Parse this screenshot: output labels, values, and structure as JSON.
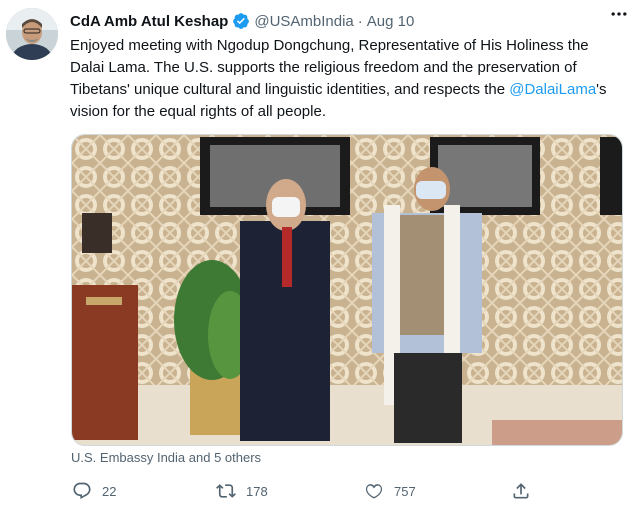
{
  "tweet": {
    "author_name": "CdA Amb Atul Keshap",
    "handle": "@USAmbIndia",
    "separator": "·",
    "date": "Aug 10",
    "text_before_mention": "Enjoyed meeting with Ngodup Dongchung, Representative of His Holiness the Dalai Lama. The U.S. supports the religious freedom and the preservation of Tibetans' unique cultural and linguistic identities, and respects the ",
    "mention": "@DalaiLama",
    "text_after_mention": "'s vision for the equal rights of all people.",
    "media_caption": "U.S. Embassy India and 5 others"
  },
  "actions": {
    "reply_count": "22",
    "retweet_count": "178",
    "like_count": "757"
  },
  "icons": {
    "verified": "verified-badge-icon",
    "more": "more-horizontal-icon",
    "reply": "reply-icon",
    "retweet": "retweet-icon",
    "like": "heart-icon",
    "share": "share-icon"
  },
  "colors": {
    "link": "#1d9bf0",
    "verified": "#1d9bf0",
    "secondary_text": "#536471"
  }
}
